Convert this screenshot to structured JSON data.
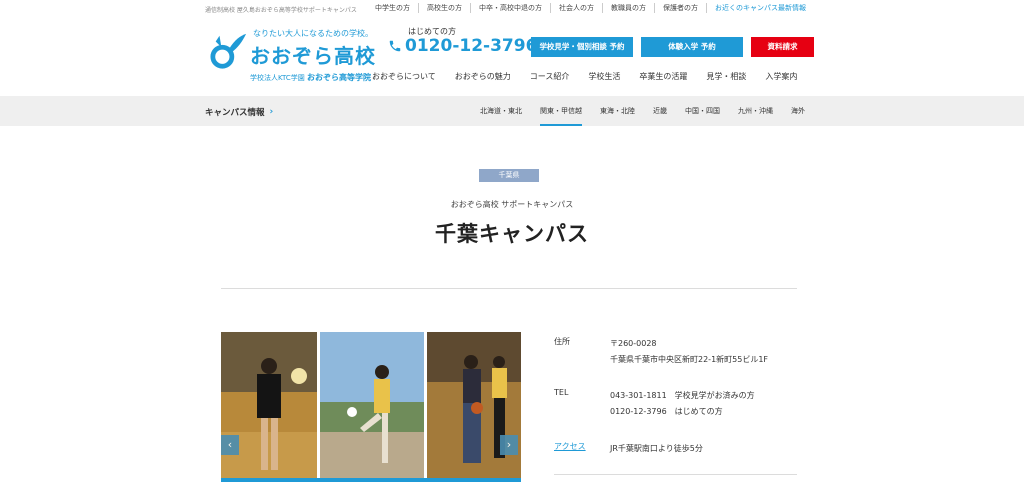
{
  "topbar": {
    "tagline": "通信制高校 屋久島おおぞら高等学校サポートキャンパス",
    "links": [
      "中学生の方",
      "高校生の方",
      "中卒・高校中退の方",
      "社会人の方",
      "教職員の方",
      "保護者の方",
      "お近くのキャンパス最新情報"
    ]
  },
  "logo": {
    "slogan": "なりたい大人になるための学校。",
    "school": "おおぞら高校",
    "sub_prefix": "学校法人KTC学園",
    "sub_name": "おおぞら高等学院"
  },
  "phone": {
    "label": "はじめての方",
    "number": "0120-12-3796"
  },
  "buttons": {
    "visit": "学校見学・個別相談 予約",
    "trial": "体験入学 予約",
    "docs": "資料請求"
  },
  "mainnav": [
    "おおぞらについて",
    "おおぞらの魅力",
    "コース紹介",
    "学校生活",
    "卒業生の活躍",
    "見学・相談",
    "入学案内"
  ],
  "campusbar": {
    "title": "キャンパス情報",
    "regions": [
      "北海道・東北",
      "関東・甲信越",
      "東海・北陸",
      "近畿",
      "中国・四国",
      "九州・沖縄",
      "海外"
    ],
    "active_region": "関東・甲信越"
  },
  "hero": {
    "prefecture": "千葉県",
    "subtitle": "おおぞら高校 サポートキャンパス",
    "title": "千葉キャンパス"
  },
  "info": {
    "address_label": "住所",
    "postal": "〒260-0028",
    "address": "千葉県千葉市中央区新町22-1新町55ビル1F",
    "tel_label": "TEL",
    "tel1": "043-301-1811　学校見学がお済みの方",
    "tel2": "0120-12-3796　はじめての方",
    "access_label": "アクセス",
    "access": "JR千葉駅南口より徒歩5分"
  },
  "colors": {
    "accent": "#1f9ad6",
    "request": "#e60012",
    "badge": "#8fa7c9"
  }
}
